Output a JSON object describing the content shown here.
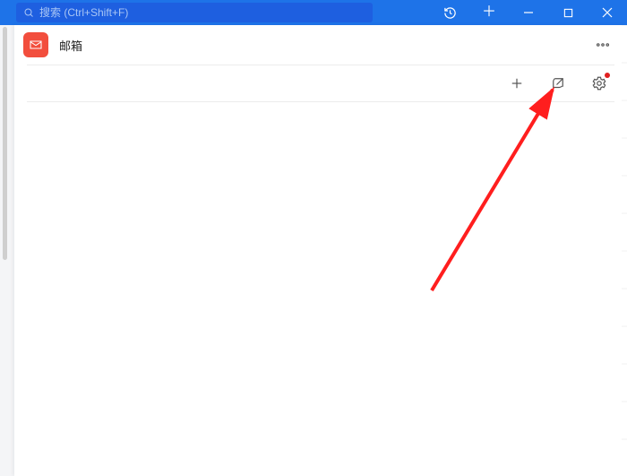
{
  "colors": {
    "primary": "#1e73e8",
    "accent": "#f24e3d",
    "arrow": "#ff1e1e"
  },
  "titlebar": {
    "search_placeholder": "搜索 (Ctrl+Shift+F)",
    "history_icon": "history-icon",
    "new_tab_icon": "plus-icon",
    "minimize_icon": "minimize-icon",
    "maximize_icon": "maximize-icon",
    "close_icon": "close-icon"
  },
  "panel": {
    "app_title": "邮箱",
    "app_icon": "mail-icon"
  },
  "toolbar": {
    "add_icon": "plus-icon",
    "open_external_icon": "open-external-icon",
    "settings_icon": "gear-icon",
    "settings_notification": true
  },
  "annotation": {
    "arrow_target": "open-external-icon"
  }
}
